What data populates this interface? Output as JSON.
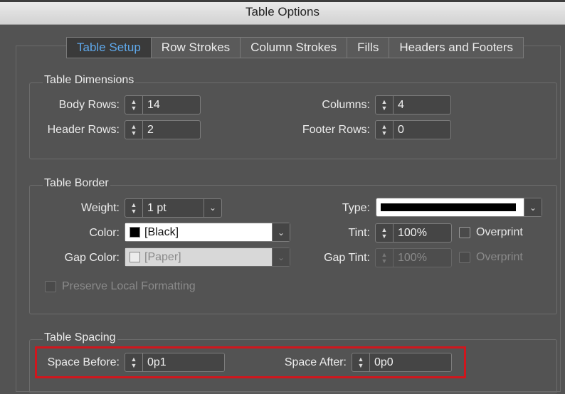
{
  "window": {
    "title": "Table Options"
  },
  "tabs": [
    "Table Setup",
    "Row Strokes",
    "Column Strokes",
    "Fills",
    "Headers and Footers"
  ],
  "dimensions": {
    "title": "Table Dimensions",
    "body_rows_label": "Body Rows:",
    "body_rows": "14",
    "header_rows_label": "Header Rows:",
    "header_rows": "2",
    "columns_label": "Columns:",
    "columns": "4",
    "footer_rows_label": "Footer Rows:",
    "footer_rows": "0"
  },
  "border": {
    "title": "Table Border",
    "weight_label": "Weight:",
    "weight": "1 pt",
    "type_label": "Type:",
    "color_label": "Color:",
    "color": "[Black]",
    "color_swatch": "#000000",
    "tint_label": "Tint:",
    "tint": "100%",
    "overprint_label": "Overprint",
    "gap_color_label": "Gap Color:",
    "gap_color": "[Paper]",
    "gap_swatch": "#ffffff",
    "gap_tint_label": "Gap Tint:",
    "gap_tint": "100%",
    "gap_overprint_label": "Overprint",
    "preserve_label": "Preserve Local Formatting"
  },
  "spacing": {
    "title": "Table Spacing",
    "space_before_label": "Space Before:",
    "space_before": "0p1",
    "space_after_label": "Space After:",
    "space_after": "0p0"
  },
  "colors": {
    "accent": "#5fa8ea",
    "highlight": "#d0161d"
  }
}
